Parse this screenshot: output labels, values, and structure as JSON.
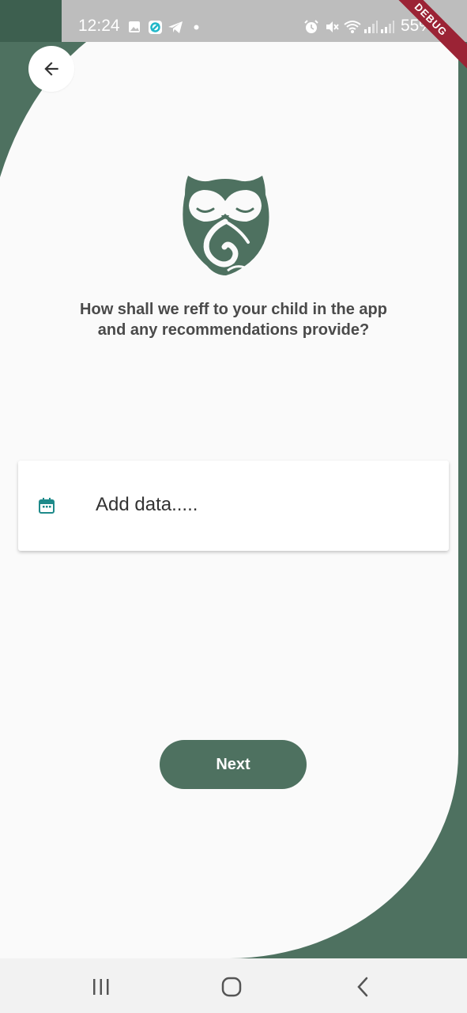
{
  "status_bar": {
    "time": "12:24",
    "battery": "55%",
    "debug_banner": "DEBUG"
  },
  "question": {
    "text": "How shall we reff to your child in the app and any recommendations provide?"
  },
  "date_field": {
    "placeholder": "Add data....."
  },
  "next_button": {
    "label": "Next"
  },
  "colors": {
    "brand_green": "#4e7160",
    "icon_teal": "#1e8a8a",
    "background": "#fafafa"
  },
  "icons": {
    "back": "arrow-back-icon",
    "logo": "owl-logo-icon",
    "calendar": "calendar-icon",
    "nav_recents": "recent-apps-icon",
    "nav_home": "home-icon",
    "nav_back": "back-chevron-icon"
  }
}
